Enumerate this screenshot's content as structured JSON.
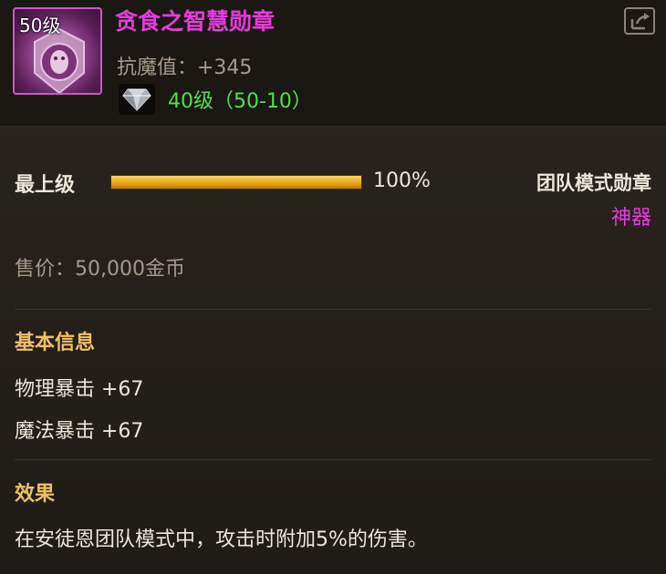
{
  "item": {
    "level_tag": "50级",
    "name": "贪食之智慧勋章",
    "stat": "抗魔值：+345",
    "gem_level": "40级（50-10）",
    "icon": "medal-icon",
    "gem_icon": "diamond-icon"
  },
  "grade": {
    "label": "最上级",
    "percent": 100,
    "percent_text": "100%"
  },
  "category": "团队模式勋章",
  "rarity": "神器",
  "price": "售价：50,000金币",
  "basic_info": {
    "title": "基本信息",
    "lines": [
      "物理暴击 +67",
      "魔法暴击 +67"
    ]
  },
  "effect": {
    "title": "效果",
    "text": "在安徒恩团队模式中，攻击时附加5%的伤害。"
  },
  "colors": {
    "name": "#e63cdc",
    "rarity": "#e63cdc",
    "gem_level": "#4fe04a",
    "section_title": "#f0c066",
    "bar": "#e8a110"
  }
}
